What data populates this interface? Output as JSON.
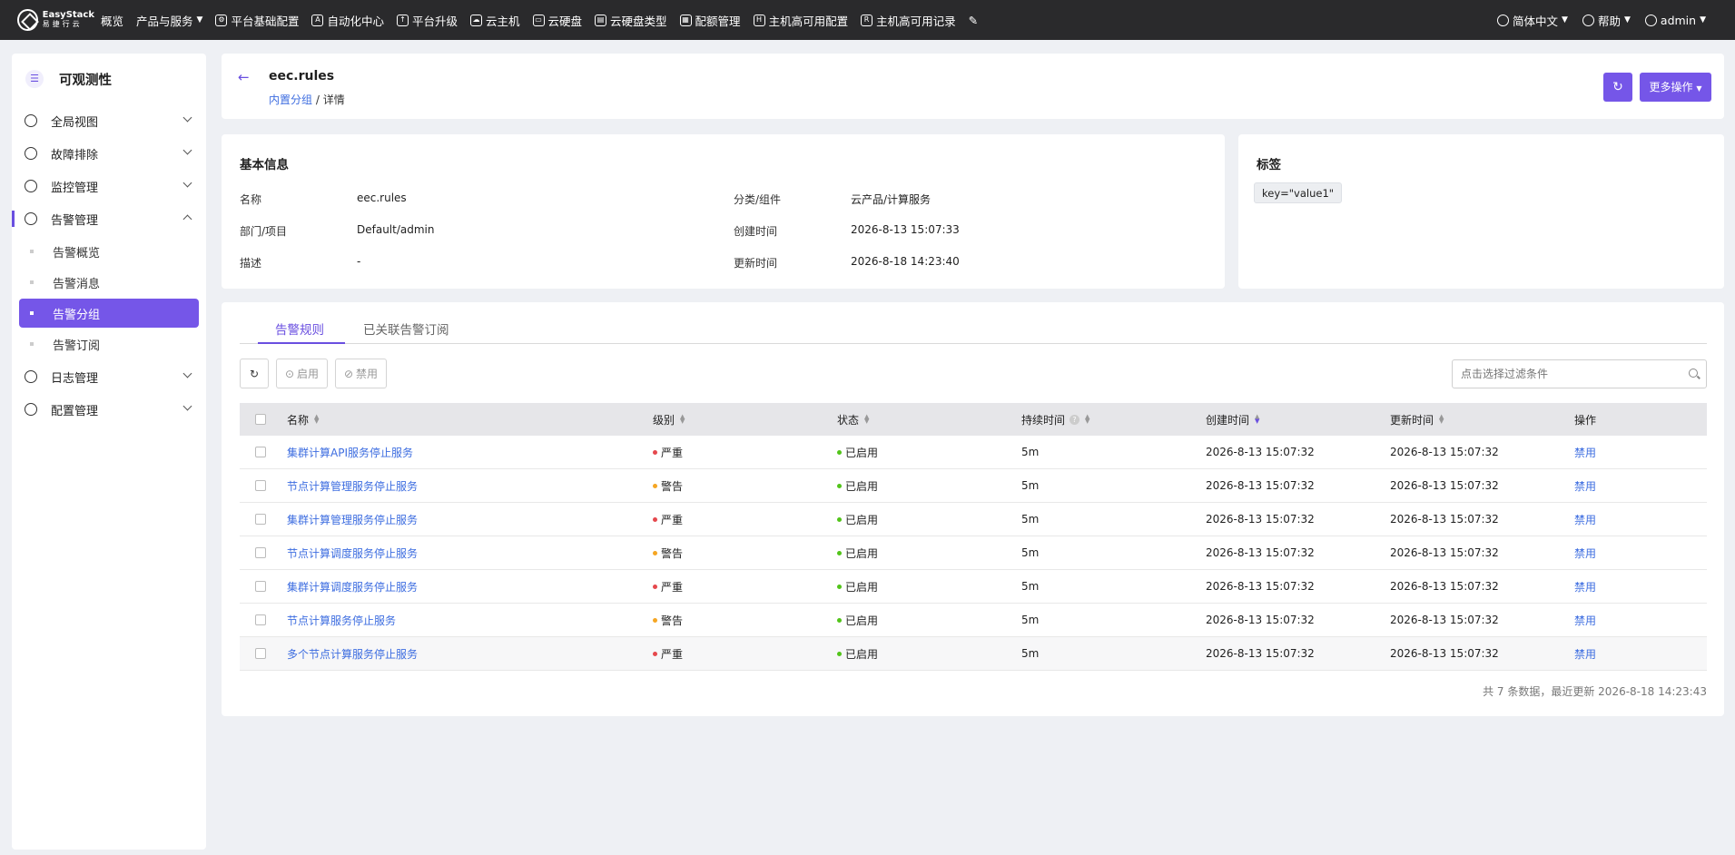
{
  "brand": {
    "line1": "EasyStack",
    "line2": "易捷行云"
  },
  "nav": {
    "items": [
      {
        "label": "概览",
        "icon": "none"
      },
      {
        "label": "产品与服务",
        "icon": "none",
        "dropdown": true
      },
      {
        "label": "平台基础配置",
        "icon": "gear-icon"
      },
      {
        "label": "自动化中心",
        "icon": "automation-icon"
      },
      {
        "label": "平台升级",
        "icon": "upgrade-icon"
      },
      {
        "label": "云主机",
        "icon": "cloud-icon"
      },
      {
        "label": "云硬盘",
        "icon": "disk-icon"
      },
      {
        "label": "云硬盘类型",
        "icon": "disk-type-icon"
      },
      {
        "label": "配额管理",
        "icon": "quota-icon"
      },
      {
        "label": "主机高可用配置",
        "icon": "ha-config-icon"
      },
      {
        "label": "主机高可用记录",
        "icon": "ha-record-icon"
      }
    ],
    "right": {
      "language": "简体中文",
      "help": "帮助",
      "user": "admin"
    }
  },
  "sidebar": {
    "title": "可观测性",
    "items": [
      {
        "label": "全局视图",
        "expanded": false
      },
      {
        "label": "故障排除",
        "expanded": false
      },
      {
        "label": "监控管理",
        "expanded": false
      },
      {
        "label": "告警管理",
        "expanded": true
      },
      {
        "label": "日志管理",
        "expanded": false
      },
      {
        "label": "配置管理",
        "expanded": false
      }
    ],
    "alert_sub": [
      {
        "label": "告警概览"
      },
      {
        "label": "告警消息"
      },
      {
        "label": "告警分组",
        "active": true
      },
      {
        "label": "告警订阅"
      }
    ]
  },
  "header": {
    "title": "eec.rules",
    "breadcrumb_parent": "内置分组",
    "breadcrumb_sep": "/",
    "breadcrumb_current": "详情",
    "more_label": "更多操作"
  },
  "basic_info": {
    "heading": "基本信息",
    "rows": [
      {
        "k1": "名称",
        "v1": "eec.rules",
        "k2": "分类/组件",
        "v2": "云产品/计算服务"
      },
      {
        "k1": "部门/项目",
        "v1": "Default/admin",
        "k2": "创建时间",
        "v2": "2026-8-13 15:07:33"
      },
      {
        "k1": "描述",
        "v1": "-",
        "k2": "更新时间",
        "v2": "2026-8-18 14:23:40"
      }
    ]
  },
  "tags": {
    "heading": "标签",
    "items": [
      "key=\"value1\""
    ]
  },
  "rules": {
    "tabs": [
      "告警规则",
      "已关联告警订阅"
    ],
    "enable_label": "启用",
    "disable_label": "禁用",
    "search_placeholder": "点击选择过滤条件",
    "columns": [
      "名称",
      "级别",
      "状态",
      "持续时间",
      "创建时间",
      "更新时间",
      "操作"
    ],
    "rows": [
      {
        "name": "集群计算API服务停止服务",
        "level": "严重",
        "status": "已启用",
        "duration": "5m",
        "created": "2026-8-13 15:07:32",
        "updated": "2026-8-13 15:07:32",
        "action": "禁用"
      },
      {
        "name": "节点计算管理服务停止服务",
        "level": "警告",
        "status": "已启用",
        "duration": "5m",
        "created": "2026-8-13 15:07:32",
        "updated": "2026-8-13 15:07:32",
        "action": "禁用"
      },
      {
        "name": "集群计算管理服务停止服务",
        "level": "严重",
        "status": "已启用",
        "duration": "5m",
        "created": "2026-8-13 15:07:32",
        "updated": "2026-8-13 15:07:32",
        "action": "禁用"
      },
      {
        "name": "节点计算调度服务停止服务",
        "level": "警告",
        "status": "已启用",
        "duration": "5m",
        "created": "2026-8-13 15:07:32",
        "updated": "2026-8-13 15:07:32",
        "action": "禁用"
      },
      {
        "name": "集群计算调度服务停止服务",
        "level": "严重",
        "status": "已启用",
        "duration": "5m",
        "created": "2026-8-13 15:07:32",
        "updated": "2026-8-13 15:07:32",
        "action": "禁用"
      },
      {
        "name": "节点计算服务停止服务",
        "level": "警告",
        "status": "已启用",
        "duration": "5m",
        "created": "2026-8-13 15:07:32",
        "updated": "2026-8-13 15:07:32",
        "action": "禁用"
      },
      {
        "name": "多个节点计算服务停止服务",
        "level": "严重",
        "status": "已启用",
        "duration": "5m",
        "created": "2026-8-13 15:07:32",
        "updated": "2026-8-13 15:07:32",
        "action": "禁用"
      }
    ],
    "footer": "共 7 条数据，最近更新  2026-8-18 14:23:43"
  },
  "colors": {
    "accent": "#7556e8",
    "link": "#3d6de0",
    "critical": "#e5484d",
    "warning": "#f5a623",
    "enabled": "#52c41a"
  }
}
